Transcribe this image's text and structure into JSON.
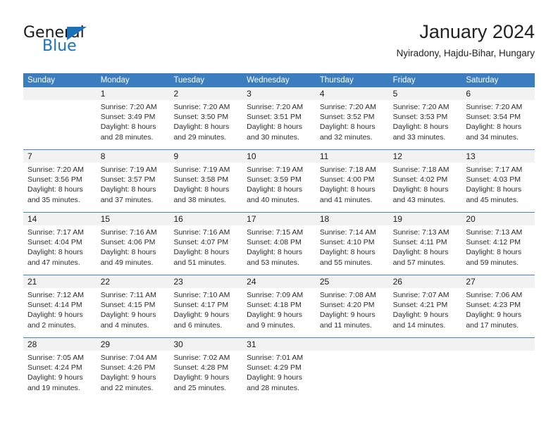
{
  "logo": {
    "word_one": "General",
    "word_two": "Blue",
    "triangle_color": "#1b72b8",
    "text_color": "#1a1a1a"
  },
  "header": {
    "title": "January 2024",
    "subtitle": "Nyiradony, Hajdu-Bihar, Hungary"
  },
  "calendar": {
    "header_bg": "#3b7dbf",
    "header_text_color": "#ffffff",
    "date_band_bg": "#f2f2f2",
    "row_divider_color": "#4a84c0",
    "weekdays": [
      "Sunday",
      "Monday",
      "Tuesday",
      "Wednesday",
      "Thursday",
      "Friday",
      "Saturday"
    ],
    "weeks": [
      [
        {
          "day": "",
          "sunrise": "",
          "sunset": "",
          "daylight_line1": "",
          "daylight_line2": ""
        },
        {
          "day": "1",
          "sunrise": "Sunrise: 7:20 AM",
          "sunset": "Sunset: 3:49 PM",
          "daylight_line1": "Daylight: 8 hours",
          "daylight_line2": "and 28 minutes."
        },
        {
          "day": "2",
          "sunrise": "Sunrise: 7:20 AM",
          "sunset": "Sunset: 3:50 PM",
          "daylight_line1": "Daylight: 8 hours",
          "daylight_line2": "and 29 minutes."
        },
        {
          "day": "3",
          "sunrise": "Sunrise: 7:20 AM",
          "sunset": "Sunset: 3:51 PM",
          "daylight_line1": "Daylight: 8 hours",
          "daylight_line2": "and 30 minutes."
        },
        {
          "day": "4",
          "sunrise": "Sunrise: 7:20 AM",
          "sunset": "Sunset: 3:52 PM",
          "daylight_line1": "Daylight: 8 hours",
          "daylight_line2": "and 32 minutes."
        },
        {
          "day": "5",
          "sunrise": "Sunrise: 7:20 AM",
          "sunset": "Sunset: 3:53 PM",
          "daylight_line1": "Daylight: 8 hours",
          "daylight_line2": "and 33 minutes."
        },
        {
          "day": "6",
          "sunrise": "Sunrise: 7:20 AM",
          "sunset": "Sunset: 3:54 PM",
          "daylight_line1": "Daylight: 8 hours",
          "daylight_line2": "and 34 minutes."
        }
      ],
      [
        {
          "day": "7",
          "sunrise": "Sunrise: 7:20 AM",
          "sunset": "Sunset: 3:56 PM",
          "daylight_line1": "Daylight: 8 hours",
          "daylight_line2": "and 35 minutes."
        },
        {
          "day": "8",
          "sunrise": "Sunrise: 7:19 AM",
          "sunset": "Sunset: 3:57 PM",
          "daylight_line1": "Daylight: 8 hours",
          "daylight_line2": "and 37 minutes."
        },
        {
          "day": "9",
          "sunrise": "Sunrise: 7:19 AM",
          "sunset": "Sunset: 3:58 PM",
          "daylight_line1": "Daylight: 8 hours",
          "daylight_line2": "and 38 minutes."
        },
        {
          "day": "10",
          "sunrise": "Sunrise: 7:19 AM",
          "sunset": "Sunset: 3:59 PM",
          "daylight_line1": "Daylight: 8 hours",
          "daylight_line2": "and 40 minutes."
        },
        {
          "day": "11",
          "sunrise": "Sunrise: 7:18 AM",
          "sunset": "Sunset: 4:00 PM",
          "daylight_line1": "Daylight: 8 hours",
          "daylight_line2": "and 41 minutes."
        },
        {
          "day": "12",
          "sunrise": "Sunrise: 7:18 AM",
          "sunset": "Sunset: 4:02 PM",
          "daylight_line1": "Daylight: 8 hours",
          "daylight_line2": "and 43 minutes."
        },
        {
          "day": "13",
          "sunrise": "Sunrise: 7:17 AM",
          "sunset": "Sunset: 4:03 PM",
          "daylight_line1": "Daylight: 8 hours",
          "daylight_line2": "and 45 minutes."
        }
      ],
      [
        {
          "day": "14",
          "sunrise": "Sunrise: 7:17 AM",
          "sunset": "Sunset: 4:04 PM",
          "daylight_line1": "Daylight: 8 hours",
          "daylight_line2": "and 47 minutes."
        },
        {
          "day": "15",
          "sunrise": "Sunrise: 7:16 AM",
          "sunset": "Sunset: 4:06 PM",
          "daylight_line1": "Daylight: 8 hours",
          "daylight_line2": "and 49 minutes."
        },
        {
          "day": "16",
          "sunrise": "Sunrise: 7:16 AM",
          "sunset": "Sunset: 4:07 PM",
          "daylight_line1": "Daylight: 8 hours",
          "daylight_line2": "and 51 minutes."
        },
        {
          "day": "17",
          "sunrise": "Sunrise: 7:15 AM",
          "sunset": "Sunset: 4:08 PM",
          "daylight_line1": "Daylight: 8 hours",
          "daylight_line2": "and 53 minutes."
        },
        {
          "day": "18",
          "sunrise": "Sunrise: 7:14 AM",
          "sunset": "Sunset: 4:10 PM",
          "daylight_line1": "Daylight: 8 hours",
          "daylight_line2": "and 55 minutes."
        },
        {
          "day": "19",
          "sunrise": "Sunrise: 7:13 AM",
          "sunset": "Sunset: 4:11 PM",
          "daylight_line1": "Daylight: 8 hours",
          "daylight_line2": "and 57 minutes."
        },
        {
          "day": "20",
          "sunrise": "Sunrise: 7:13 AM",
          "sunset": "Sunset: 4:12 PM",
          "daylight_line1": "Daylight: 8 hours",
          "daylight_line2": "and 59 minutes."
        }
      ],
      [
        {
          "day": "21",
          "sunrise": "Sunrise: 7:12 AM",
          "sunset": "Sunset: 4:14 PM",
          "daylight_line1": "Daylight: 9 hours",
          "daylight_line2": "and 2 minutes."
        },
        {
          "day": "22",
          "sunrise": "Sunrise: 7:11 AM",
          "sunset": "Sunset: 4:15 PM",
          "daylight_line1": "Daylight: 9 hours",
          "daylight_line2": "and 4 minutes."
        },
        {
          "day": "23",
          "sunrise": "Sunrise: 7:10 AM",
          "sunset": "Sunset: 4:17 PM",
          "daylight_line1": "Daylight: 9 hours",
          "daylight_line2": "and 6 minutes."
        },
        {
          "day": "24",
          "sunrise": "Sunrise: 7:09 AM",
          "sunset": "Sunset: 4:18 PM",
          "daylight_line1": "Daylight: 9 hours",
          "daylight_line2": "and 9 minutes."
        },
        {
          "day": "25",
          "sunrise": "Sunrise: 7:08 AM",
          "sunset": "Sunset: 4:20 PM",
          "daylight_line1": "Daylight: 9 hours",
          "daylight_line2": "and 11 minutes."
        },
        {
          "day": "26",
          "sunrise": "Sunrise: 7:07 AM",
          "sunset": "Sunset: 4:21 PM",
          "daylight_line1": "Daylight: 9 hours",
          "daylight_line2": "and 14 minutes."
        },
        {
          "day": "27",
          "sunrise": "Sunrise: 7:06 AM",
          "sunset": "Sunset: 4:23 PM",
          "daylight_line1": "Daylight: 9 hours",
          "daylight_line2": "and 17 minutes."
        }
      ],
      [
        {
          "day": "28",
          "sunrise": "Sunrise: 7:05 AM",
          "sunset": "Sunset: 4:24 PM",
          "daylight_line1": "Daylight: 9 hours",
          "daylight_line2": "and 19 minutes."
        },
        {
          "day": "29",
          "sunrise": "Sunrise: 7:04 AM",
          "sunset": "Sunset: 4:26 PM",
          "daylight_line1": "Daylight: 9 hours",
          "daylight_line2": "and 22 minutes."
        },
        {
          "day": "30",
          "sunrise": "Sunrise: 7:02 AM",
          "sunset": "Sunset: 4:28 PM",
          "daylight_line1": "Daylight: 9 hours",
          "daylight_line2": "and 25 minutes."
        },
        {
          "day": "31",
          "sunrise": "Sunrise: 7:01 AM",
          "sunset": "Sunset: 4:29 PM",
          "daylight_line1": "Daylight: 9 hours",
          "daylight_line2": "and 28 minutes."
        },
        {
          "day": "",
          "sunrise": "",
          "sunset": "",
          "daylight_line1": "",
          "daylight_line2": ""
        },
        {
          "day": "",
          "sunrise": "",
          "sunset": "",
          "daylight_line1": "",
          "daylight_line2": ""
        },
        {
          "day": "",
          "sunrise": "",
          "sunset": "",
          "daylight_line1": "",
          "daylight_line2": ""
        }
      ]
    ]
  }
}
